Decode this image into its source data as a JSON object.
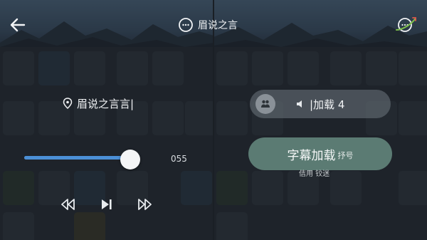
{
  "left": {
    "title": "眉说之言",
    "center_label": "眉说之言言|",
    "slider": {
      "value_text": "055",
      "fraction": 0.93
    },
    "controls": [
      "rewind-icon",
      "play-next-icon",
      "fast-forward-icon"
    ]
  },
  "right": {
    "pill_text": "|加载 4",
    "button_main": "字幕加载",
    "button_sub": "抒号",
    "caption": "佶用 铰迷"
  },
  "colors": {
    "slider_fill": "#4b8fd6",
    "button_bg": "#5b7b73",
    "pill_bg": "#6e767e"
  }
}
